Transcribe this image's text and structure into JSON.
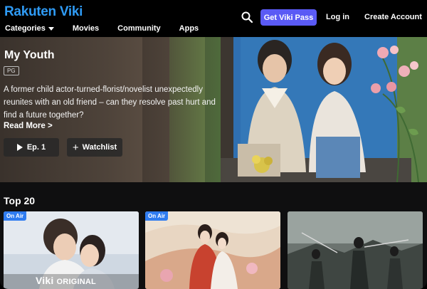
{
  "header": {
    "logo": "Rakuten Viki",
    "nav": [
      "Categories",
      "Movies",
      "Community",
      "Apps"
    ],
    "get_pass": "Get Viki Pass",
    "login": "Log in",
    "create_account": "Create Account",
    "accent": "#5a5af5",
    "logo_color": "#2f9bf5"
  },
  "hero": {
    "title": "My Youth",
    "rating": "PG",
    "synopsis": "A former child actor-turned-florist/novelist unexpectedly reunites with an old friend – can they resolve past hurt and find a future together?",
    "read_more": "Read More >",
    "episode_button": "Ep. 1",
    "watchlist_button": "Watchlist"
  },
  "top20": {
    "title": "Top 20",
    "cards": [
      {
        "badge": "On Air",
        "overlay": "Viki",
        "overlay_small": "ORIGINAL"
      },
      {
        "badge": "On Air"
      },
      {}
    ]
  }
}
